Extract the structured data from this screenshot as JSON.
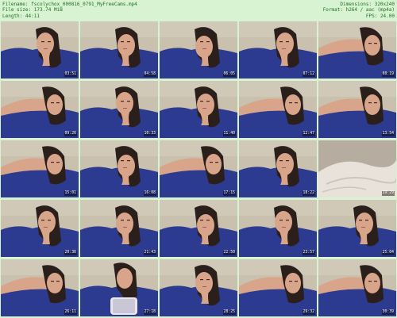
{
  "header": {
    "filename": "Filename: fscolychox_000816_0791_MyFreeCams.mp4",
    "filesize": "File size: 173.74 MiB",
    "length": "Length: 44:11",
    "dimensions": "Dimensions: 320x240",
    "format": "Format: h264 / aac (mp4a)",
    "fps": "FPS: 24.00"
  },
  "thumbnails": [
    {
      "time": "03:51",
      "scene": "face"
    },
    {
      "time": "04:58",
      "scene": "face"
    },
    {
      "time": "06:05",
      "scene": "face"
    },
    {
      "time": "07:12",
      "scene": "face"
    },
    {
      "time": "08:19",
      "scene": "lean"
    },
    {
      "time": "09:26",
      "scene": "lean"
    },
    {
      "time": "10:33",
      "scene": "face"
    },
    {
      "time": "11:40",
      "scene": "face"
    },
    {
      "time": "12:47",
      "scene": "lean"
    },
    {
      "time": "13:54",
      "scene": "lean"
    },
    {
      "time": "15:01",
      "scene": "lean"
    },
    {
      "time": "16:08",
      "scene": "face"
    },
    {
      "time": "17:15",
      "scene": "lean"
    },
    {
      "time": "18:22",
      "scene": "face"
    },
    {
      "time": "19:29",
      "scene": "bed"
    },
    {
      "time": "20:36",
      "scene": "face"
    },
    {
      "time": "21:43",
      "scene": "face"
    },
    {
      "time": "22:50",
      "scene": "face"
    },
    {
      "time": "23:57",
      "scene": "face"
    },
    {
      "time": "25:04",
      "scene": "face"
    },
    {
      "time": "26:11",
      "scene": "lean"
    },
    {
      "time": "27:18",
      "scene": "phone"
    },
    {
      "time": "28:25",
      "scene": "face"
    },
    {
      "time": "29:32",
      "scene": "lean"
    },
    {
      "time": "30:39",
      "scene": "lean"
    }
  ],
  "colors": {
    "background": "#d8f3d2",
    "header_text": "#1f6f20",
    "wall": "#c9c1ad",
    "shirt": "#2c3a8f",
    "hair": "#2a1f1a",
    "skin": "#d9a58a",
    "bed": "#e8e2da"
  }
}
